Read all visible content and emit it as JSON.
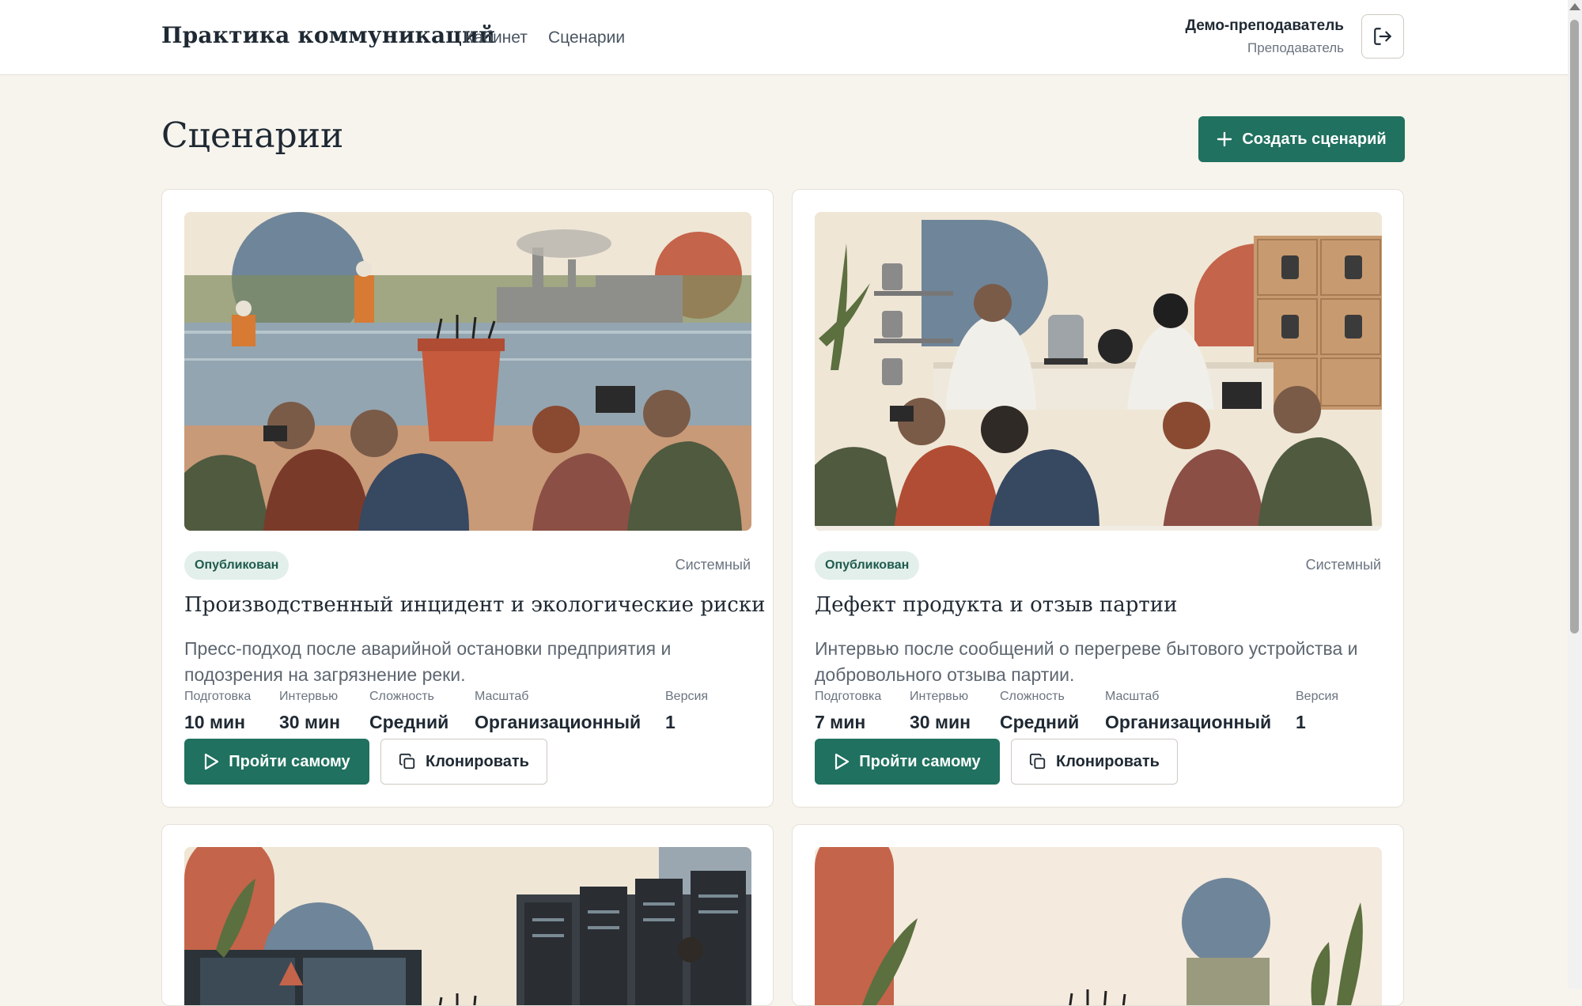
{
  "header": {
    "brand": "Практика коммуникаций",
    "nav": [
      "Кабинет",
      "Сценарии"
    ],
    "user_name": "Демо-преподаватель",
    "user_role": "Преподаватель",
    "logout_icon": "logout-icon"
  },
  "page": {
    "title": "Сценарии",
    "create_button": "Создать сценарий"
  },
  "colors": {
    "accent": "#20715f",
    "badge_bg": "#e3efea",
    "page_bg": "#f7f4ee"
  },
  "cards": [
    {
      "status": "Опубликован",
      "type": "Системный",
      "title": "Производственный инцидент и экологические риски",
      "description": "Пресс-подход после аварийной остановки предприятия и подозрения на загрязнение реки.",
      "meta": [
        {
          "label": "Подготовка",
          "value": "10 мин"
        },
        {
          "label": "Интервью",
          "value": "30 мин"
        },
        {
          "label": "Сложность",
          "value": "Средний"
        },
        {
          "label": "Масштаб",
          "value": "Организационный"
        },
        {
          "label": "Версия",
          "value": "1"
        }
      ],
      "primary_button": "Пройти самому",
      "secondary_button": "Клонировать"
    },
    {
      "status": "Опубликован",
      "type": "Системный",
      "title": "Дефект продукта и отзыв партии",
      "description": "Интервью после сообщений о перегреве бытового устройства и добровольного отзыва партии.",
      "meta": [
        {
          "label": "Подготовка",
          "value": "7 мин"
        },
        {
          "label": "Интервью",
          "value": "30 мин"
        },
        {
          "label": "Сложность",
          "value": "Средний"
        },
        {
          "label": "Масштаб",
          "value": "Организационный"
        },
        {
          "label": "Версия",
          "value": "1"
        }
      ],
      "primary_button": "Пройти самому",
      "secondary_button": "Клонировать"
    }
  ]
}
